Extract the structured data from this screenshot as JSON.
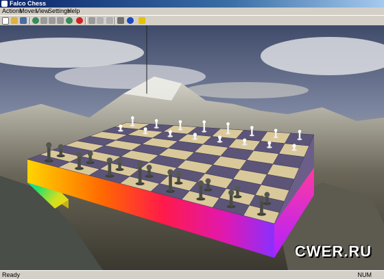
{
  "window": {
    "title": "Falco Chess"
  },
  "menu": [
    {
      "label": "Actions"
    },
    {
      "label": "Moves"
    },
    {
      "label": "View"
    },
    {
      "label": "Settings"
    },
    {
      "label": "Help"
    }
  ],
  "toolbar": [
    {
      "icon": "new-game-icon"
    },
    {
      "icon": "open-icon"
    },
    {
      "icon": "save-icon"
    },
    {
      "icon": "undo-all-icon"
    },
    {
      "icon": "undo-icon"
    },
    {
      "icon": "play-icon"
    },
    {
      "icon": "redo-icon"
    },
    {
      "icon": "redo-all-icon"
    },
    {
      "icon": "stop-icon"
    },
    {
      "icon": "pause-icon"
    },
    {
      "icon": "flip-board-icon"
    },
    {
      "icon": "hint-icon"
    },
    {
      "icon": "go-icon"
    },
    {
      "icon": "analyze-icon"
    },
    {
      "icon": "help-icon"
    }
  ],
  "statusbar": {
    "text": "Ready",
    "right": "NUM"
  },
  "watermark": "CWER.RU"
}
